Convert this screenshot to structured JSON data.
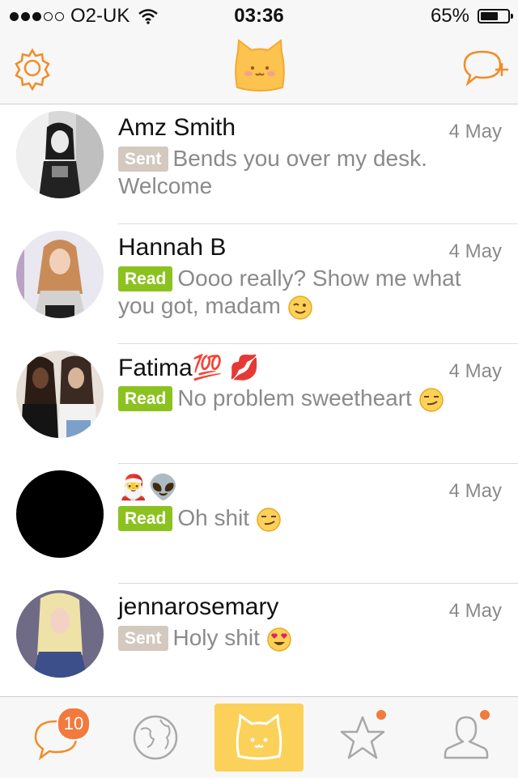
{
  "status_bar": {
    "carrier": "O2-UK",
    "time": "03:36",
    "battery_label": "65%",
    "battery_level": 0.65
  },
  "header": {
    "settings_icon": "gear-icon",
    "logo_icon": "cat-logo-icon",
    "new_chat_icon": "new-chat-bubble-plus-icon"
  },
  "conversations": [
    {
      "name": "Amz Smith",
      "date": "4 May",
      "status": "Sent",
      "message": "Bends you over my desk. Welcome",
      "emoji": ""
    },
    {
      "name": "Hannah B",
      "date": "4 May",
      "status": "Read",
      "message": "Oooo really? Show me what you got, madam",
      "emoji": "winking-face"
    },
    {
      "name": "Fatima💯 💋",
      "date": "4 May",
      "status": "Read",
      "message": "No problem sweetheart",
      "emoji": "smirking-face"
    },
    {
      "name": "🎅👽",
      "date": "4 May",
      "status": "Read",
      "message": "Oh shit",
      "emoji": "smirking-face"
    },
    {
      "name": "jennarosemary",
      "date": "4 May",
      "status": "Sent",
      "message": "Holy shit",
      "emoji": "heart-eyes-face"
    }
  ],
  "tab_bar": {
    "chats_badge": "10",
    "tabs": [
      "chats",
      "discover",
      "home",
      "favorites",
      "profile"
    ],
    "active_tab": "home",
    "accent": "#f28c28",
    "active_bg": "#fcd15a"
  }
}
